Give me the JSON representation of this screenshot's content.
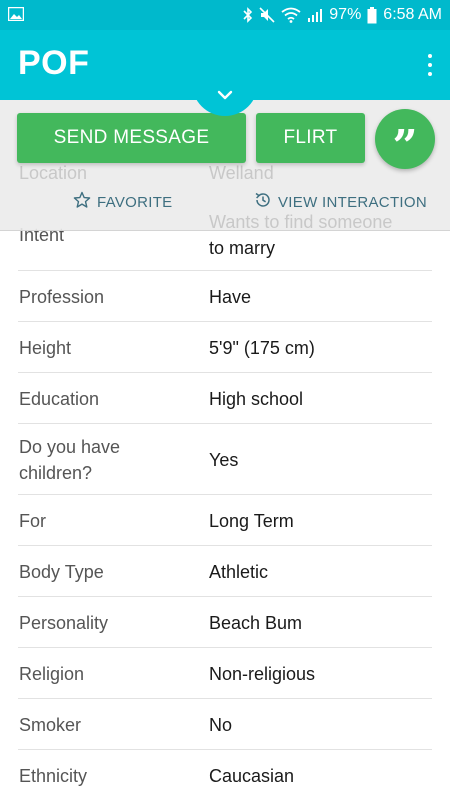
{
  "status_bar": {
    "battery": "97%",
    "time": "6:58 AM"
  },
  "app_bar": {
    "title": "POF"
  },
  "actions": {
    "send_message": "SEND MESSAGE",
    "flirt": "FLIRT",
    "quote_glyph": "”",
    "favorite": "FAVORITE",
    "view_interaction": "VIEW INTERACTION"
  },
  "underlay": {
    "location_label": "Location",
    "location_value": "Welland",
    "intent_value_line1": "Wants to find someone"
  },
  "profile": {
    "intent_label": "Intent",
    "intent_value_line2": "to marry",
    "rows": [
      {
        "label": "Profession",
        "value": "Have"
      },
      {
        "label": "Height",
        "value": "5'9\" (175 cm)"
      },
      {
        "label": "Education",
        "value": "High school"
      },
      {
        "label": "Do you have children?",
        "label_line1": "Do you have",
        "label_line2": "children?",
        "value": "Yes"
      },
      {
        "label": "For",
        "value": "Long Term"
      },
      {
        "label": "Body Type",
        "value": "Athletic"
      },
      {
        "label": "Personality",
        "value": "Beach Bum"
      },
      {
        "label": "Religion",
        "value": "Non-religious"
      },
      {
        "label": "Smoker",
        "value": "No"
      },
      {
        "label": "Ethnicity",
        "value": "Caucasian"
      }
    ]
  },
  "colors": {
    "accent": "#00c4d6",
    "status": "#00b9cc",
    "button": "#43b85c",
    "link": "#3e6f80"
  }
}
